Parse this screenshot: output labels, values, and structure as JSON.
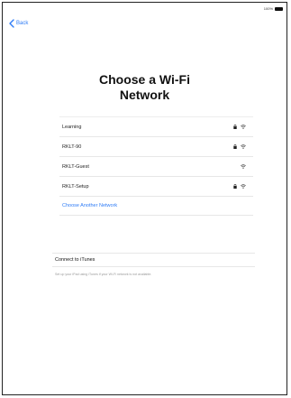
{
  "status": {
    "battery_percent": "100%"
  },
  "nav": {
    "back_label": "Back"
  },
  "title": {
    "line1": "Choose a Wi-Fi",
    "line2": "Network"
  },
  "networks": [
    {
      "name": "Learning",
      "locked": true
    },
    {
      "name": "RKLT-90",
      "locked": true
    },
    {
      "name": "RKLT-Guest",
      "locked": false
    },
    {
      "name": "RKLT-Setup",
      "locked": true
    }
  ],
  "other_network_label": "Choose Another Network",
  "itunes": {
    "label": "Connect to iTunes",
    "note": "Set up your iPad using iTunes if your Wi-Fi network is not available."
  },
  "colors": {
    "accent": "#2f7cf6"
  }
}
